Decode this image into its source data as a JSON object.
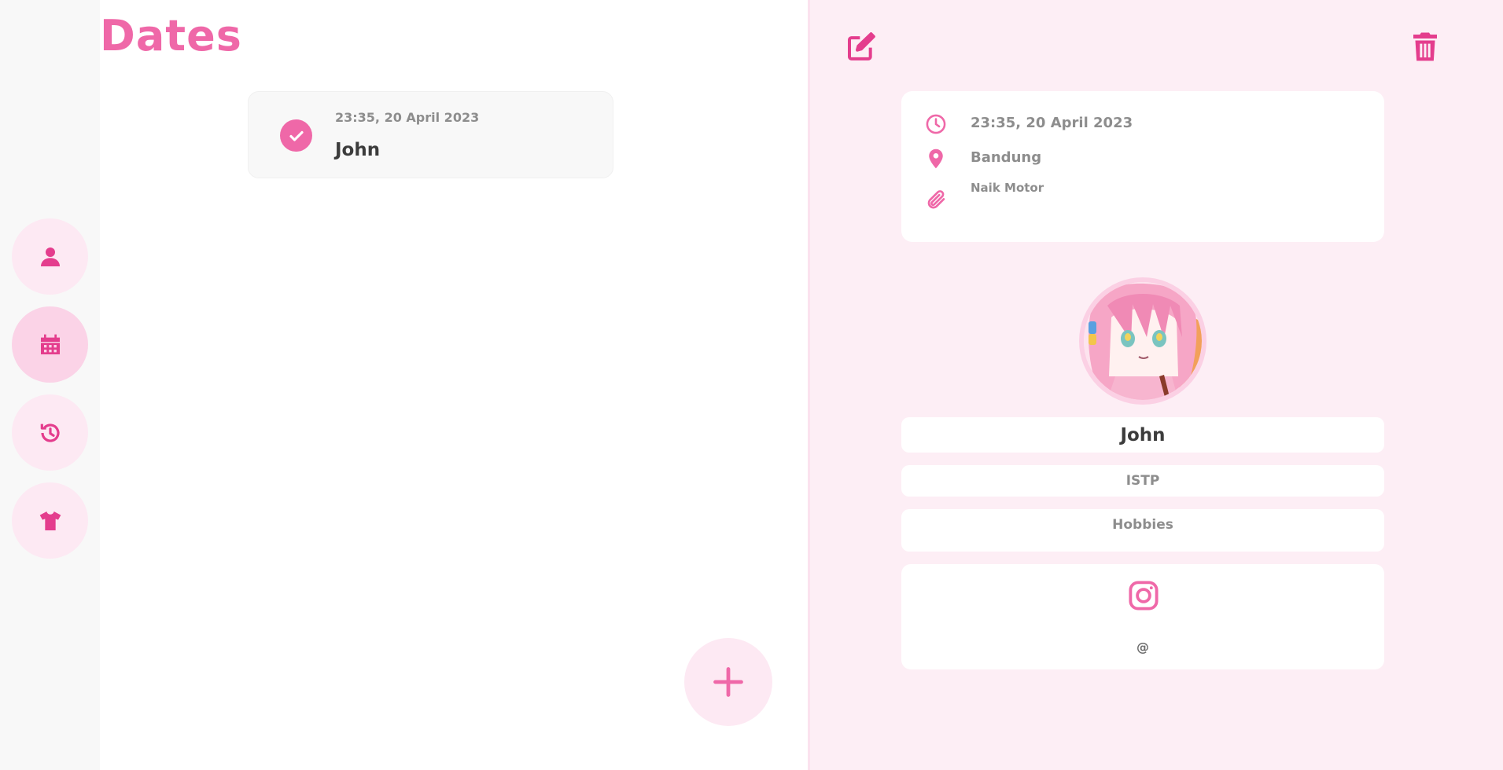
{
  "page": {
    "title": "Dates"
  },
  "colors": {
    "accent": "#ef68a8",
    "accent_dark": "#e43d8d",
    "pink_light": "#fde9f3",
    "pink_bg": "#fdeef5"
  },
  "sidebar": {
    "items": [
      {
        "icon": "person-icon",
        "active": false
      },
      {
        "icon": "calendar-icon",
        "active": true
      },
      {
        "icon": "history-icon",
        "active": false
      },
      {
        "icon": "shirt-icon",
        "active": false
      }
    ]
  },
  "dates_list": [
    {
      "time": "23:35, 20 April 2023",
      "name": "John",
      "icon": "check-circle-icon"
    }
  ],
  "add_button": {
    "icon": "plus-icon"
  },
  "detail": {
    "toolbar": {
      "edit_icon": "edit-icon",
      "delete_icon": "trash-icon"
    },
    "info": {
      "time": "23:35, 20 April 2023",
      "location": "Bandung",
      "note": "Naik Motor"
    },
    "profile": {
      "name": "John",
      "mbti": "ISTP",
      "hobbies": "Hobbies",
      "instagram_handle": "@"
    }
  }
}
